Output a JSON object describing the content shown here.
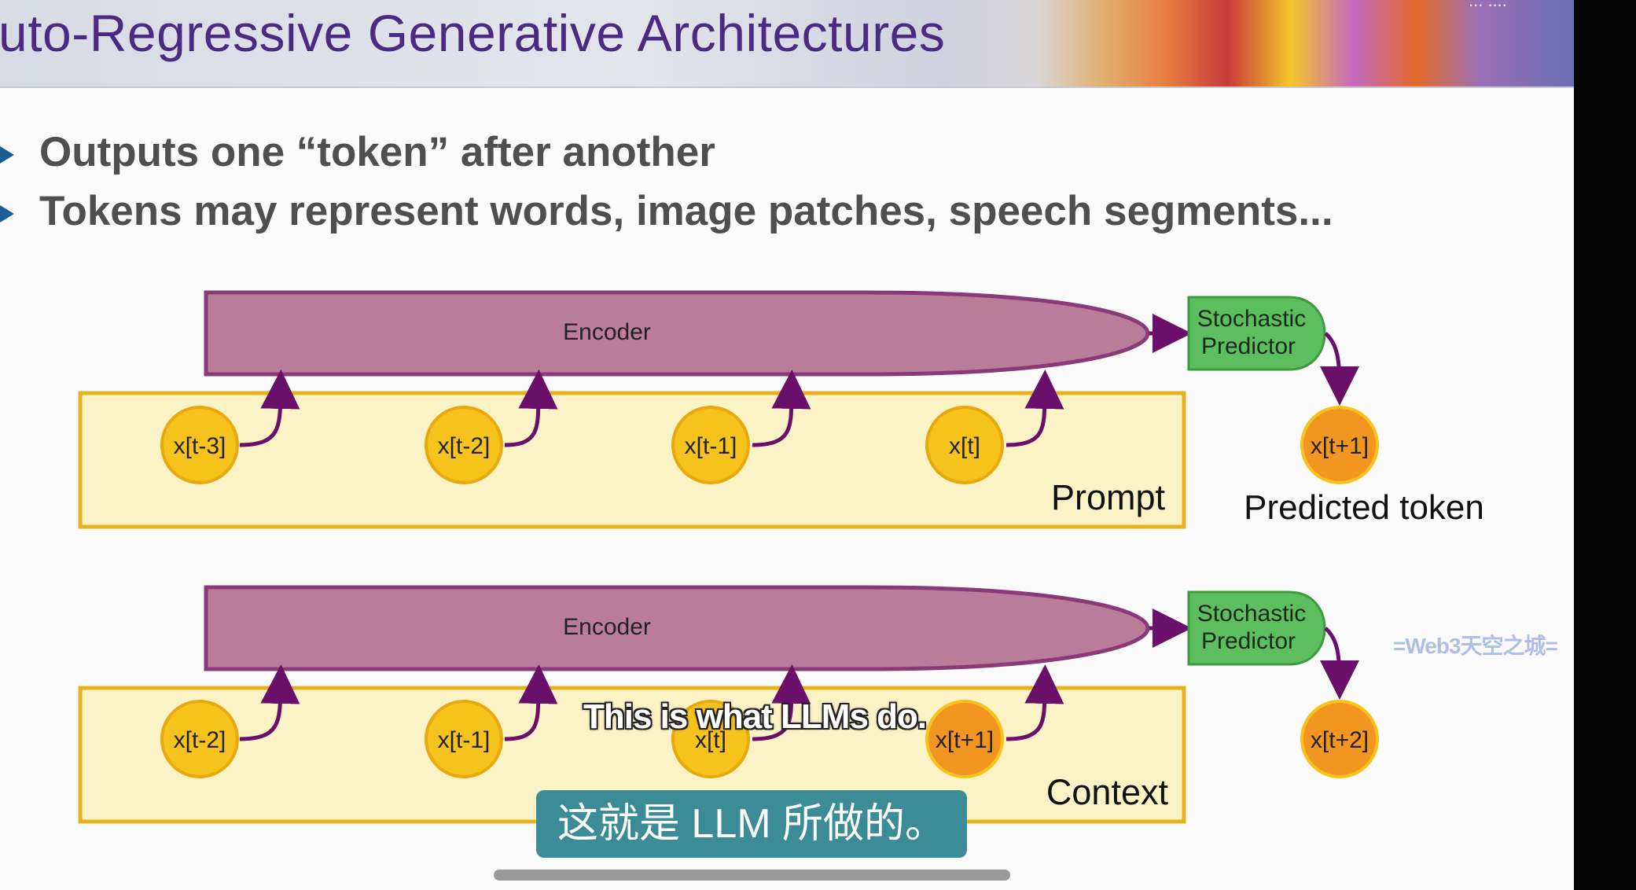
{
  "slide": {
    "title": "uto-Regressive Generative Architectures",
    "corner_text": "... ....",
    "bullets": [
      "Outputs one “token” after another",
      "Tokens may represent words, image patches, speech segments..."
    ]
  },
  "diagram": {
    "top": {
      "encoder_label": "Encoder",
      "predictor_label_line1": "Stochastic",
      "predictor_label_line2": "Predictor",
      "tokens": [
        "x[t-3]",
        "x[t-2]",
        "x[t-1]",
        "x[t]"
      ],
      "box_label": "Prompt",
      "output_token": "x[t+1]",
      "output_label": "Predicted token"
    },
    "bottom": {
      "encoder_label": "Encoder",
      "predictor_label_line1": "Stochastic",
      "predictor_label_line2": "Predictor",
      "tokens": [
        "x[t-2]",
        "x[t-1]",
        "x[t]",
        "x[t+1]"
      ],
      "box_label": "Context",
      "output_token": "x[t+2]"
    }
  },
  "overlay": {
    "subtitle_en": "This is what LLMs do.",
    "subtitle_zh": "这就是 LLM 所做的。",
    "watermark": "=Web3天空之城="
  },
  "colors": {
    "title": "#4a2a82",
    "encoder_fill": "#b97d9a",
    "encoder_stroke": "#8a3a78",
    "arrow": "#6a0f6a",
    "box_fill": "#fbf3c6",
    "box_stroke": "#e6b31e",
    "token_yellow": "#f6c21c",
    "token_orange": "#f39521",
    "predictor_fill": "#5cbe5e",
    "subtitle_bg": "#3b8c97"
  }
}
